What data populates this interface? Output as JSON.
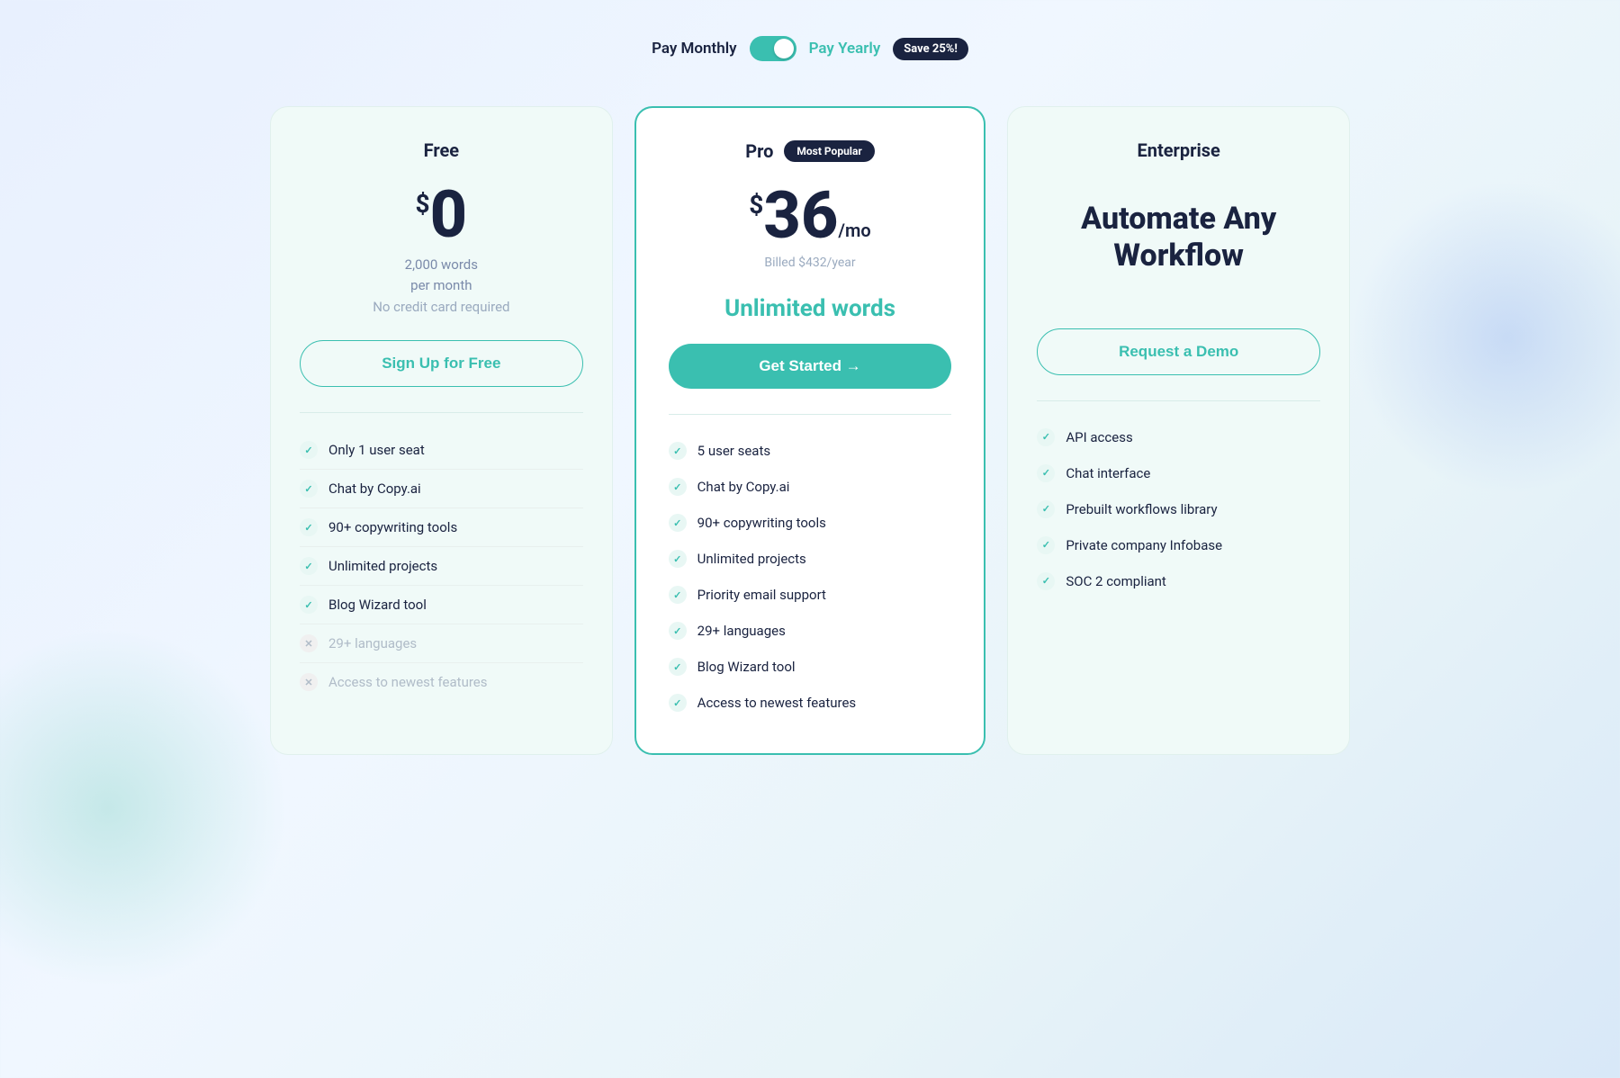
{
  "billing": {
    "pay_monthly_label": "Pay Monthly",
    "pay_yearly_label": "Pay Yearly",
    "save_badge": "Save 25%!",
    "toggle_active": "yearly"
  },
  "plans": {
    "free": {
      "name": "Free",
      "price_symbol": "$",
      "price_number": "0",
      "price_subtitle_1": "2,000 words",
      "price_subtitle_2": "per month",
      "no_credit": "No credit card required",
      "cta_label": "Sign Up for Free",
      "features": [
        {
          "text": "Only 1 user seat",
          "enabled": true
        },
        {
          "text": "Chat by Copy.ai",
          "enabled": true
        },
        {
          "text": "90+ copywriting tools",
          "enabled": true
        },
        {
          "text": "Unlimited projects",
          "enabled": true
        },
        {
          "text": "Blog Wizard tool",
          "enabled": true
        },
        {
          "text": "29+ languages",
          "enabled": false
        },
        {
          "text": "Access to newest features",
          "enabled": false
        }
      ]
    },
    "pro": {
      "name": "Pro",
      "most_popular_badge": "Most Popular",
      "price_symbol": "$",
      "price_number": "36",
      "price_period": "/mo",
      "billed_text": "Billed $432/year",
      "unlimited_text": "Unlimited words",
      "cta_label": "Get Started →",
      "features": [
        {
          "text": "5 user seats",
          "enabled": true
        },
        {
          "text": "Chat by Copy.ai",
          "enabled": true
        },
        {
          "text": "90+ copywriting tools",
          "enabled": true
        },
        {
          "text": "Unlimited projects",
          "enabled": true
        },
        {
          "text": "Priority email support",
          "enabled": true
        },
        {
          "text": "29+ languages",
          "enabled": true
        },
        {
          "text": "Blog Wizard tool",
          "enabled": true
        },
        {
          "text": "Access to newest features",
          "enabled": true
        }
      ]
    },
    "enterprise": {
      "name": "Enterprise",
      "headline": "Automate Any Workflow",
      "cta_label": "Request a Demo",
      "features": [
        {
          "text": "API access",
          "enabled": true
        },
        {
          "text": "Chat interface",
          "enabled": true
        },
        {
          "text": "Prebuilt workflows library",
          "enabled": true
        },
        {
          "text": "Private company Infobase",
          "enabled": true
        },
        {
          "text": "SOC 2 compliant",
          "enabled": true
        }
      ]
    }
  }
}
